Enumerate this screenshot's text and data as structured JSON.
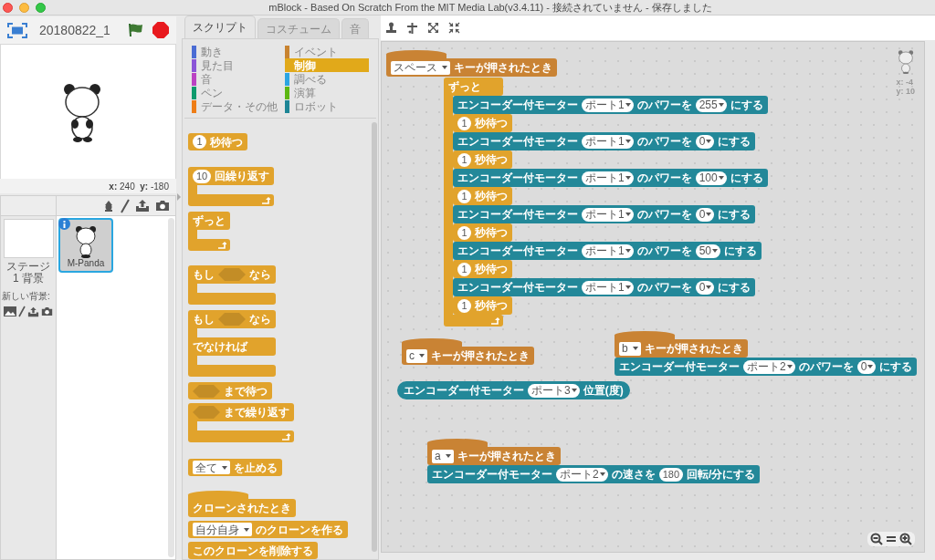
{
  "window": {
    "title": "mBlock - Based On Scratch From the MIT Media Lab(v3.4.11) - 接続されていません - 保存しました"
  },
  "stage": {
    "project_name": "20180822_1",
    "coordinates": "**x:** 240  **y:** -180"
  },
  "sprites_pane": {
    "stage": {
      "label": "ステージ",
      "backdrops": "1 背景",
      "new_backdrop": "新しい背景:"
    },
    "sprites": [
      {
        "name": "M-Panda",
        "selected": true
      }
    ]
  },
  "palette": {
    "tabs": [
      {
        "label": "スクリプト",
        "selected": true
      },
      {
        "label": "コスチューム",
        "selected": false
      },
      {
        "label": "音",
        "selected": false
      }
    ],
    "categories": [
      {
        "label": "動き",
        "color": "#4a6cd4",
        "selected": false
      },
      {
        "label": "見た目",
        "color": "#8a55d7",
        "selected": false
      },
      {
        "label": "音",
        "color": "#bb42c3",
        "selected": false
      },
      {
        "label": "ペン",
        "color": "#0e9a6c",
        "selected": false
      },
      {
        "label": "データ・その他",
        "color": "#ee7d16",
        "selected": false
      },
      {
        "label": "イベント",
        "color": "#c88330",
        "selected": false
      },
      {
        "label": "制御",
        "color": "#e1a91a",
        "selected": true
      },
      {
        "label": "調べる",
        "color": "#2ca5e2",
        "selected": false
      },
      {
        "label": "演算",
        "color": "#5cb712",
        "selected": false
      },
      {
        "label": "ロボット",
        "color": "#1d8595",
        "selected": false
      }
    ],
    "blocks": [
      {
        "kind": "stack",
        "color": "#e1a32c",
        "parts": [
          {
            "kind": "number",
            "text": "1"
          },
          {
            "kind": "text",
            "text": "秒待つ"
          }
        ]
      },
      {
        "kind": "loop",
        "color": "#e1a32c",
        "parts": [
          {
            "kind": "number",
            "text": "10"
          },
          {
            "kind": "text",
            "text": "回繰り返す"
          }
        ]
      },
      {
        "kind": "loop",
        "color": "#e1a32c",
        "parts": [
          {
            "kind": "text",
            "text": "ずっと"
          }
        ]
      },
      {
        "kind": "if",
        "color": "#e1a32c",
        "parts": [
          {
            "kind": "text",
            "text": "もし"
          },
          {
            "kind": "boolean"
          },
          {
            "kind": "text",
            "text": "なら"
          }
        ]
      },
      {
        "kind": "if_else",
        "color": "#e1a32c",
        "parts": [
          {
            "kind": "text",
            "text": "もし"
          },
          {
            "kind": "boolean"
          },
          {
            "kind": "text",
            "text": "なら"
          }
        ],
        "else_label": "でなければ"
      },
      {
        "kind": "stack",
        "color": "#e1a32c",
        "parts": [
          {
            "kind": "boolean"
          },
          {
            "kind": "text",
            "text": "まで待つ"
          }
        ]
      },
      {
        "kind": "loop",
        "color": "#e1a32c",
        "parts": [
          {
            "kind": "boolean"
          },
          {
            "kind": "text",
            "text": "まで繰り返す"
          }
        ]
      },
      {
        "kind": "stack",
        "color": "#e1a32c",
        "parts": [
          {
            "kind": "menu",
            "text": "全て"
          },
          {
            "kind": "text",
            "text": "を止める"
          }
        ]
      },
      {
        "kind": "hat",
        "color": "#e1a32c",
        "parts": [
          {
            "kind": "text",
            "text": "クローンされたとき"
          }
        ]
      },
      {
        "kind": "stack",
        "color": "#e1a32c",
        "parts": [
          {
            "kind": "menu",
            "text": "自分自身"
          },
          {
            "kind": "text",
            "text": "のクローンを作る"
          }
        ]
      },
      {
        "kind": "stack",
        "color": "#e1a32c",
        "parts": [
          {
            "kind": "text",
            "text": "このクローンを削除する"
          }
        ]
      }
    ]
  },
  "sprite_info": {
    "x": "x: -4",
    "y": "y: 10"
  },
  "scripts": [
    {
      "blocks": [
        {
          "kind": "hat",
          "color": "#c98334",
          "parts": [
            {
              "kind": "menu",
              "text": "スペース"
            },
            {
              "kind": "text",
              "text": "キーが押されたとき"
            }
          ]
        }
      ]
    },
    {
      "blocks": [
        {
          "kind": "loop",
          "color": "#e1a32c",
          "parts": [
            {
              "kind": "text",
              "text": "ずっと"
            }
          ],
          "children": [
            {
              "kind": "stack",
              "color": "#238899",
              "parts": [
                {
                  "kind": "text",
                  "text": "エンコーダー付モーター"
                },
                {
                  "kind": "dropdown",
                  "text": "ポート1"
                },
                {
                  "kind": "text",
                  "text": "のパワーを"
                },
                {
                  "kind": "dropdown",
                  "text": "255"
                },
                {
                  "kind": "text",
                  "text": "にする"
                }
              ]
            },
            {
              "kind": "stack",
              "color": "#e1a32c",
              "parts": [
                {
                  "kind": "number",
                  "text": "1"
                },
                {
                  "kind": "text",
                  "text": "秒待つ"
                }
              ]
            },
            {
              "kind": "stack",
              "color": "#238899",
              "parts": [
                {
                  "kind": "text",
                  "text": "エンコーダー付モーター"
                },
                {
                  "kind": "dropdown",
                  "text": "ポート1"
                },
                {
                  "kind": "text",
                  "text": "のパワーを"
                },
                {
                  "kind": "dropdown",
                  "text": "0"
                },
                {
                  "kind": "text",
                  "text": "にする"
                }
              ]
            },
            {
              "kind": "stack",
              "color": "#e1a32c",
              "parts": [
                {
                  "kind": "number",
                  "text": "1"
                },
                {
                  "kind": "text",
                  "text": "秒待つ"
                }
              ]
            },
            {
              "kind": "stack",
              "color": "#238899",
              "parts": [
                {
                  "kind": "text",
                  "text": "エンコーダー付モーター"
                },
                {
                  "kind": "dropdown",
                  "text": "ポート1"
                },
                {
                  "kind": "text",
                  "text": "のパワーを"
                },
                {
                  "kind": "dropdown",
                  "text": "100"
                },
                {
                  "kind": "text",
                  "text": "にする"
                }
              ]
            },
            {
              "kind": "stack",
              "color": "#e1a32c",
              "parts": [
                {
                  "kind": "number",
                  "text": "1"
                },
                {
                  "kind": "text",
                  "text": "秒待つ"
                }
              ]
            },
            {
              "kind": "stack",
              "color": "#238899",
              "parts": [
                {
                  "kind": "text",
                  "text": "エンコーダー付モーター"
                },
                {
                  "kind": "dropdown",
                  "text": "ポート1"
                },
                {
                  "kind": "text",
                  "text": "のパワーを"
                },
                {
                  "kind": "dropdown",
                  "text": "0"
                },
                {
                  "kind": "text",
                  "text": "にする"
                }
              ]
            },
            {
              "kind": "stack",
              "color": "#e1a32c",
              "parts": [
                {
                  "kind": "number",
                  "text": "1"
                },
                {
                  "kind": "text",
                  "text": "秒待つ"
                }
              ]
            },
            {
              "kind": "stack",
              "color": "#238899",
              "parts": [
                {
                  "kind": "text",
                  "text": "エンコーダー付モーター"
                },
                {
                  "kind": "dropdown",
                  "text": "ポート1"
                },
                {
                  "kind": "text",
                  "text": "のパワーを"
                },
                {
                  "kind": "dropdown",
                  "text": "50"
                },
                {
                  "kind": "text",
                  "text": "にする"
                }
              ]
            },
            {
              "kind": "stack",
              "color": "#e1a32c",
              "parts": [
                {
                  "kind": "number",
                  "text": "1"
                },
                {
                  "kind": "text",
                  "text": "秒待つ"
                }
              ]
            },
            {
              "kind": "stack",
              "color": "#238899",
              "parts": [
                {
                  "kind": "text",
                  "text": "エンコーダー付モーター"
                },
                {
                  "kind": "dropdown",
                  "text": "ポート1"
                },
                {
                  "kind": "text",
                  "text": "のパワーを"
                },
                {
                  "kind": "dropdown",
                  "text": "0"
                },
                {
                  "kind": "text",
                  "text": "にする"
                }
              ]
            },
            {
              "kind": "stack",
              "color": "#e1a32c",
              "parts": [
                {
                  "kind": "number",
                  "text": "1"
                },
                {
                  "kind": "text",
                  "text": "秒待つ"
                }
              ]
            }
          ]
        }
      ]
    },
    {
      "blocks": [
        {
          "kind": "hat",
          "color": "#c98334",
          "parts": [
            {
              "kind": "menu",
              "text": "c"
            },
            {
              "kind": "text",
              "text": "キーが押されたとき"
            }
          ]
        }
      ]
    },
    {
      "blocks": [
        {
          "kind": "reporter",
          "color": "#238899",
          "parts": [
            {
              "kind": "text",
              "text": "エンコーダー付モーター"
            },
            {
              "kind": "dropdown",
              "text": "ポート3"
            },
            {
              "kind": "text",
              "text": "位置(度)"
            }
          ]
        }
      ]
    },
    {
      "blocks": [
        {
          "kind": "hat",
          "color": "#c98334",
          "parts": [
            {
              "kind": "menu",
              "text": "b"
            },
            {
              "kind": "text",
              "text": "キーが押されたとき"
            }
          ]
        },
        {
          "kind": "stack",
          "color": "#238899",
          "parts": [
            {
              "kind": "text",
              "text": "エンコーダー付モーター"
            },
            {
              "kind": "dropdown",
              "text": "ポート2"
            },
            {
              "kind": "text",
              "text": "のパワーを"
            },
            {
              "kind": "dropdown",
              "text": "0"
            },
            {
              "kind": "text",
              "text": "にする"
            }
          ]
        }
      ]
    },
    {
      "blocks": [
        {
          "kind": "hat",
          "color": "#c98334",
          "parts": [
            {
              "kind": "menu",
              "text": "a"
            },
            {
              "kind": "text",
              "text": "キーが押されたとき"
            }
          ]
        },
        {
          "kind": "stack",
          "color": "#238899",
          "parts": [
            {
              "kind": "text",
              "text": "エンコーダー付モーター"
            },
            {
              "kind": "dropdown",
              "text": "ポート2"
            },
            {
              "kind": "text",
              "text": "の速さを"
            },
            {
              "kind": "number",
              "text": "180"
            },
            {
              "kind": "text",
              "text": "回転/分にする"
            }
          ]
        }
      ]
    }
  ]
}
